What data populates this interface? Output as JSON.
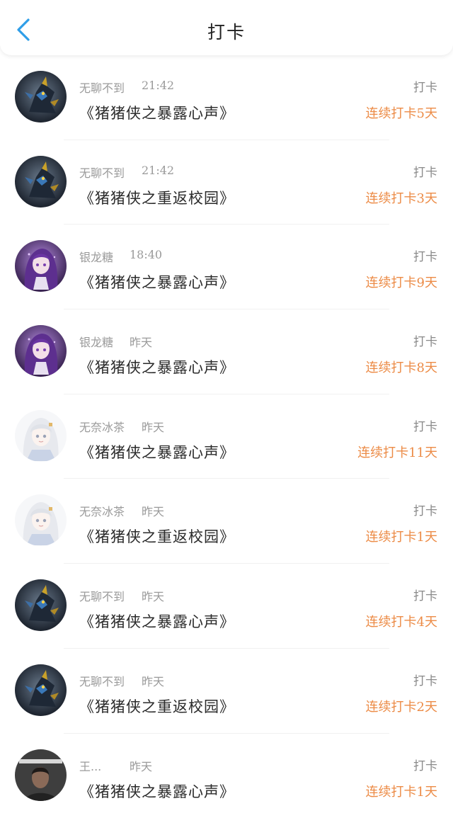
{
  "header": {
    "title": "打卡"
  },
  "items": [
    {
      "name": "无聊不到",
      "time": "21:42",
      "book": "《猪猪侠之暴露心声》",
      "action": "打卡",
      "streak": "连续打卡5天",
      "avatar": "dark-mech"
    },
    {
      "name": "无聊不到",
      "time": "21:42",
      "book": "《猪猪侠之重返校园》",
      "action": "打卡",
      "streak": "连续打卡3天",
      "avatar": "dark-mech"
    },
    {
      "name": "银龙糖",
      "time": "18:40",
      "book": "《猪猪侠之暴露心声》",
      "action": "打卡",
      "streak": "连续打卡9天",
      "avatar": "purple-anime"
    },
    {
      "name": "银龙糖",
      "time": "昨天",
      "book": "《猪猪侠之暴露心声》",
      "action": "打卡",
      "streak": "连续打卡8天",
      "avatar": "purple-anime"
    },
    {
      "name": "无奈冰茶",
      "time": "昨天",
      "book": "《猪猪侠之暴露心声》",
      "action": "打卡",
      "streak": "连续打卡11天",
      "avatar": "white-anime"
    },
    {
      "name": "无奈冰茶",
      "time": "昨天",
      "book": "《猪猪侠之重返校园》",
      "action": "打卡",
      "streak": "连续打卡1天",
      "avatar": "white-anime"
    },
    {
      "name": "无聊不到",
      "time": "昨天",
      "book": "《猪猪侠之暴露心声》",
      "action": "打卡",
      "streak": "连续打卡4天",
      "avatar": "dark-mech"
    },
    {
      "name": "无聊不到",
      "time": "昨天",
      "book": "《猪猪侠之重返校园》",
      "action": "打卡",
      "streak": "连续打卡2天",
      "avatar": "dark-mech"
    },
    {
      "name": "王...",
      "time": "昨天",
      "book": "《猪猪侠之暴露心声》",
      "action": "打卡",
      "streak": "连续打卡1天",
      "avatar": "photo-person"
    }
  ],
  "colors": {
    "accent": "#ec8b46",
    "back": "#2f9ee8",
    "muted": "#9a9a9a"
  }
}
